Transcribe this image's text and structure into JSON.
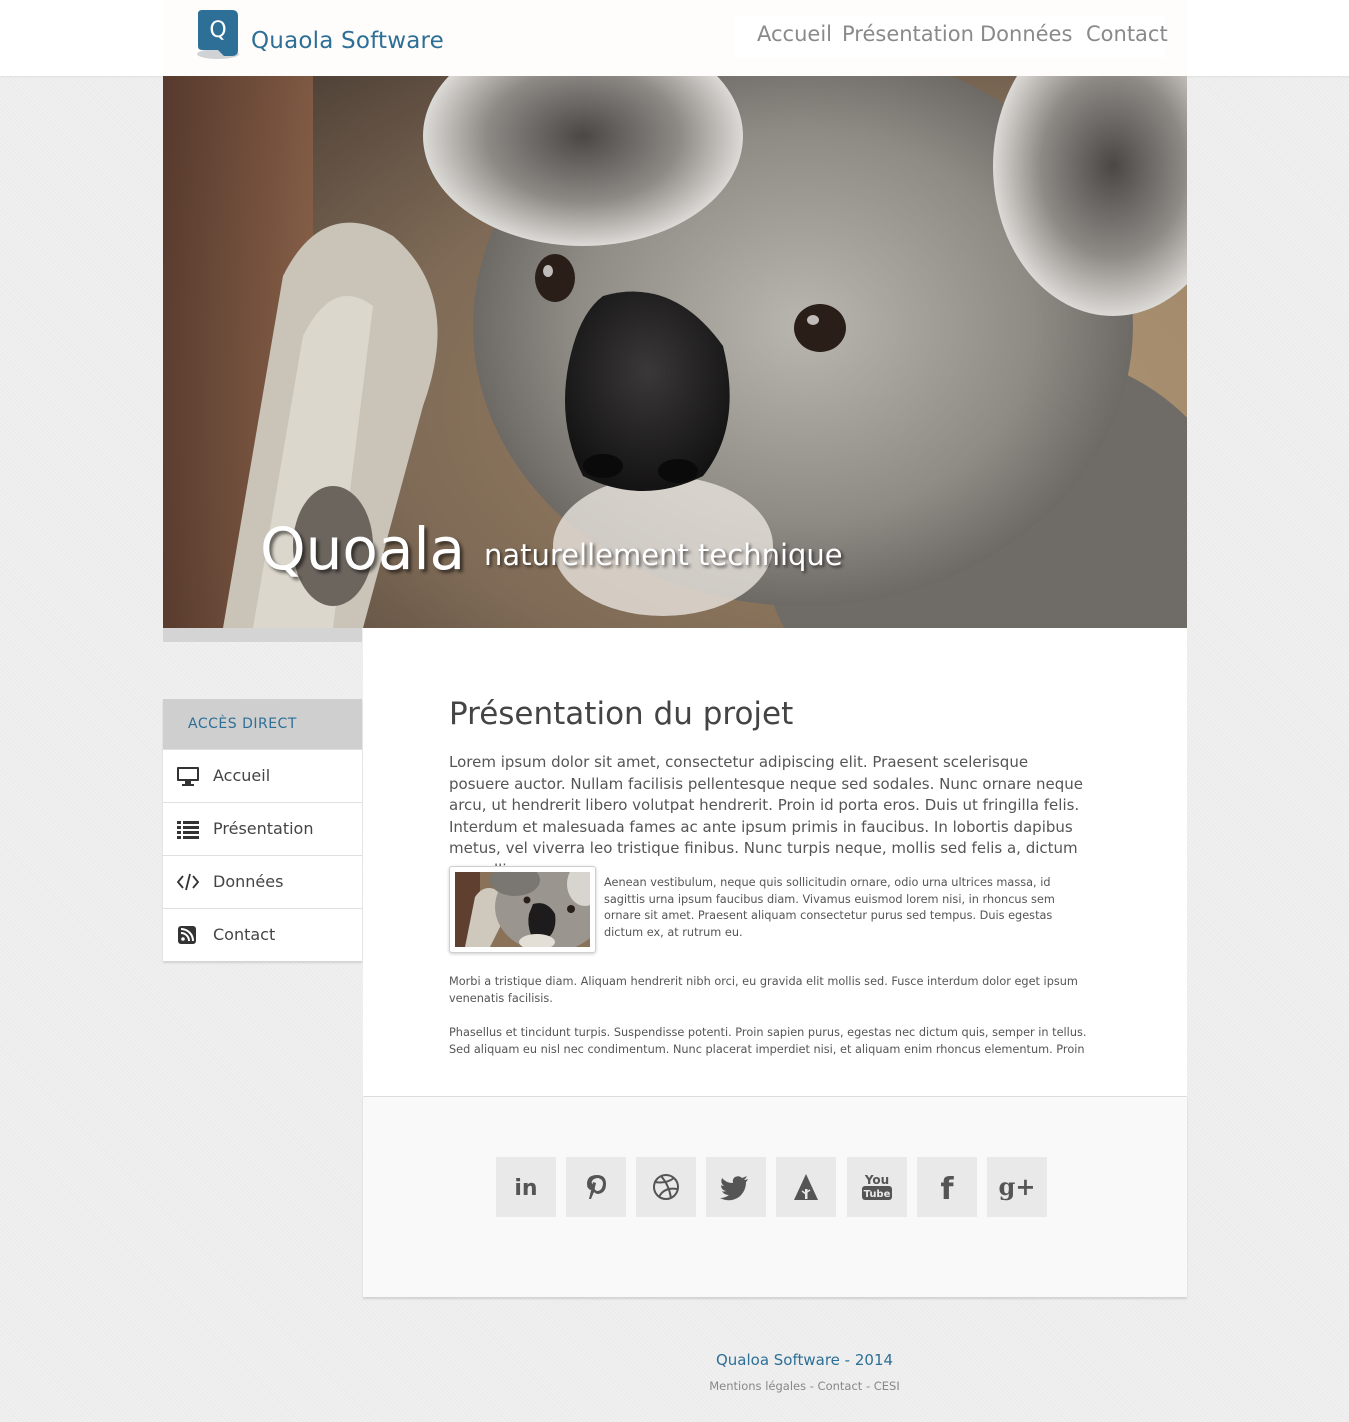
{
  "brand": {
    "name": "Quaola Software",
    "logo_letter": "Q",
    "color": "#2d6f96"
  },
  "nav": [
    {
      "label": "Accueil"
    },
    {
      "label": "Présentation"
    },
    {
      "label": "Données"
    },
    {
      "label": "Contact"
    }
  ],
  "hero": {
    "title": "Quoala",
    "tagline": "naturellement technique",
    "image": "koala-photo"
  },
  "sidebar": {
    "title": "ACCÈS DIRECT",
    "items": [
      {
        "label": "Accueil",
        "icon": "monitor-icon"
      },
      {
        "label": "Présentation",
        "icon": "list-icon"
      },
      {
        "label": "Données",
        "icon": "code-icon"
      },
      {
        "label": "Contact",
        "icon": "rss-icon"
      }
    ]
  },
  "content": {
    "title": "Présentation du projet",
    "intro": "Lorem ipsum dolor sit amet, consectetur adipiscing elit. Praesent scelerisque posuere auctor. Nullam facilisis pellentesque neque sed sodales. Nunc ornare neque arcu, ut hendrerit libero volutpat hendrerit. Proin id porta eros. Duis ut fringilla felis. Interdum et malesuada fames ac ante ipsum primis in faucibus. In lobortis dapibus metus, vel viverra leo tristique finibus. Nunc turpis neque, mollis sed felis a, dictum convallis quam.",
    "paragraph2": "Aenean vestibulum, neque quis sollicitudin ornare, odio urna ultrices massa, id sagittis urna ipsum faucibus diam. Vivamus euismod lorem nisi, in rhoncus sem ornare sit amet. Praesent aliquam consectetur purus sed tempus. Duis egestas dictum ex, at rutrum eu.",
    "paragraph3": "Morbi a tristique diam. Aliquam hendrerit nibh orci, eu gravida elit mollis sed. Fusce interdum dolor eget ipsum venenatis facilisis.",
    "paragraph4": "Phasellus et tincidunt turpis. Suspendisse potenti. Proin sapien purus, egestas nec dictum quis, semper in tellus. Sed aliquam eu nisl nec condimentum. Nunc placerat imperdiet nisi, et aliquam enim rhoncus elementum. Proin"
  },
  "social": [
    {
      "icon": "linkedin-icon",
      "label": "in"
    },
    {
      "icon": "pinterest-icon"
    },
    {
      "icon": "dribbble-icon"
    },
    {
      "icon": "twitter-icon"
    },
    {
      "icon": "forrst-icon"
    },
    {
      "icon": "youtube-icon",
      "label_top": "You",
      "label_bottom": "Tube"
    },
    {
      "icon": "facebook-icon",
      "label": "f"
    },
    {
      "icon": "google-plus-icon",
      "label": "g+"
    }
  ],
  "footer": {
    "title": "Qualoa Software - 2014",
    "links": [
      "Mentions légales",
      "Contact",
      "CESI"
    ],
    "separator": " - "
  }
}
